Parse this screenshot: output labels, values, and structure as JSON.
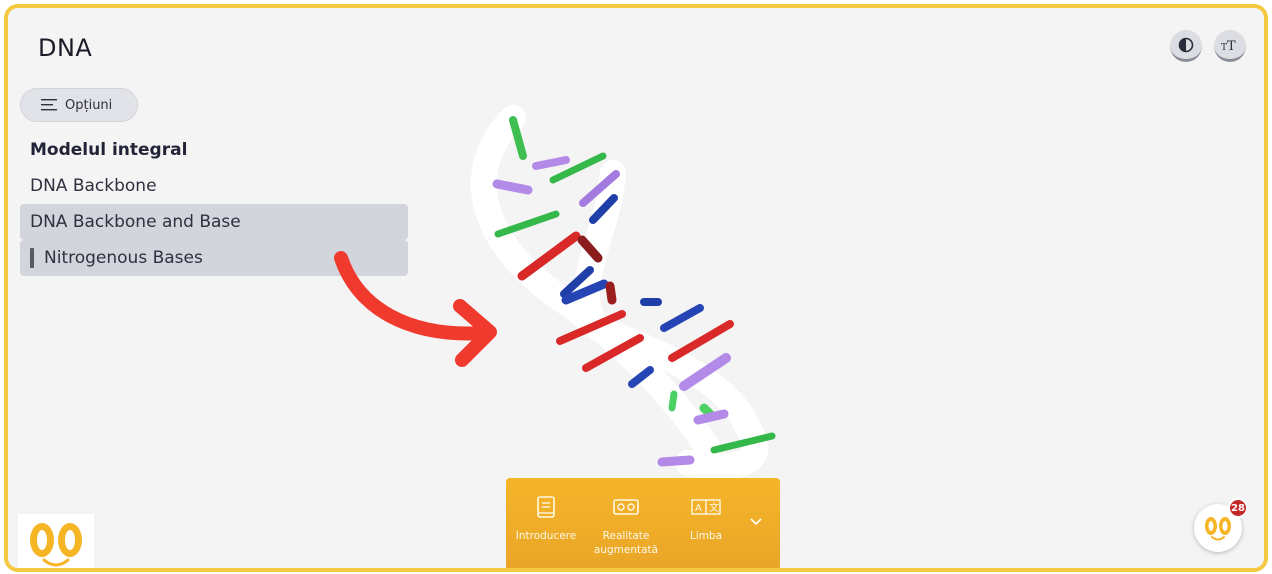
{
  "header": {
    "title": "DNA"
  },
  "options_button": {
    "label": "Opțiuni"
  },
  "menu": {
    "items": [
      {
        "label": "Modelul integral"
      },
      {
        "label": "DNA Backbone"
      },
      {
        "label": "DNA Backbone and Base"
      },
      {
        "label": "Nitrogenous Bases"
      }
    ]
  },
  "toolbar": {
    "items": [
      {
        "label": "Introducere",
        "icon": "book-icon"
      },
      {
        "label": "Realitate augmentată",
        "icon": "vr-headset-icon"
      },
      {
        "label": "Limba",
        "icon": "translate-icon"
      }
    ]
  },
  "notifications": {
    "count": "28"
  },
  "colors": {
    "accent": "#f4b529",
    "frame": "#f5c842",
    "arrow": "#f03a2e",
    "notification": "#c62828"
  }
}
